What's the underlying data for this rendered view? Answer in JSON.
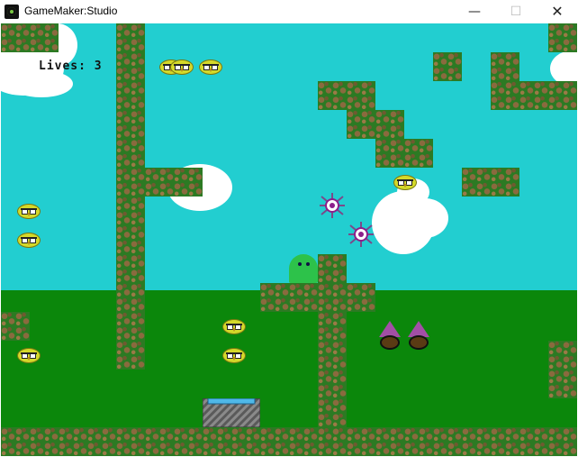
{
  "window": {
    "title": "GameMaker:Studio",
    "minimize_glyph": "—",
    "maximize_glyph": "☐",
    "close_glyph": "✕"
  },
  "hud": {
    "lives_text": "Lives: 3"
  },
  "colors": {
    "sky": "#22ced0",
    "grass": "#0b870b",
    "block": "#2c7a23",
    "enemy_bird": "#d4d92a",
    "ghost": "#2dc24a",
    "wizard_hat": "#a24fa6",
    "spider": "#8c1f8c"
  },
  "icons": {
    "app": "gamemaker-logo-icon"
  }
}
